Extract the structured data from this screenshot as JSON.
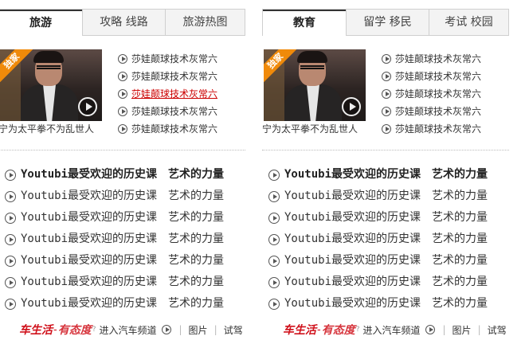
{
  "columns": [
    {
      "tabs": [
        "旅游",
        "攻略 线路",
        "旅游热图"
      ],
      "active_tab": 0,
      "feature": {
        "badge": "独家",
        "caption": "宁为太平拳不为乱世人"
      },
      "small_list": [
        "莎娃颠球技术灰常六",
        "莎娃颠球技术灰常六",
        "莎娃颠球技术灰常六",
        "莎娃颠球技术灰常六",
        "莎娃颠球技术灰常六"
      ],
      "highlight_index": 2,
      "big_list": [
        {
          "t1": "Youtubi最受欢迎的历史课",
          "t2": "艺术的力量",
          "bold": true
        },
        {
          "t1": "Youtubi最受欢迎的历史课",
          "t2": "艺术的力量",
          "bold": false
        },
        {
          "t1": "Youtubi最受欢迎的历史课",
          "t2": "艺术的力量",
          "bold": false
        },
        {
          "t1": "Youtubi最受欢迎的历史课",
          "t2": "艺术的力量",
          "bold": false
        },
        {
          "t1": "Youtubi最受欢迎的历史课",
          "t2": "艺术的力量",
          "bold": false
        },
        {
          "t1": "Youtubi最受欢迎的历史课",
          "t2": "艺术的力量",
          "bold": false
        },
        {
          "t1": "Youtubi最受欢迎的历史课",
          "t2": "艺术的力量",
          "bold": false
        }
      ],
      "footer": {
        "brand_a": "车生活",
        "brand_b": "有态度",
        "brand_q": "?",
        "link": "进入汽车频道",
        "items": [
          "图片",
          "试驾"
        ]
      }
    },
    {
      "tabs": [
        "教育",
        "留学 移民",
        "考试 校园"
      ],
      "active_tab": 0,
      "feature": {
        "badge": "独家",
        "caption": "宁为太平拳不为乱世人"
      },
      "small_list": [
        "莎娃颠球技术灰常六",
        "莎娃颠球技术灰常六",
        "莎娃颠球技术灰常六",
        "莎娃颠球技术灰常六",
        "莎娃颠球技术灰常六"
      ],
      "highlight_index": -1,
      "big_list": [
        {
          "t1": "Youtubi最受欢迎的历史课",
          "t2": "艺术的力量",
          "bold": true
        },
        {
          "t1": "Youtubi最受欢迎的历史课",
          "t2": "艺术的力量",
          "bold": false
        },
        {
          "t1": "Youtubi最受欢迎的历史课",
          "t2": "艺术的力量",
          "bold": false
        },
        {
          "t1": "Youtubi最受欢迎的历史课",
          "t2": "艺术的力量",
          "bold": false
        },
        {
          "t1": "Youtubi最受欢迎的历史课",
          "t2": "艺术的力量",
          "bold": false
        },
        {
          "t1": "Youtubi最受欢迎的历史课",
          "t2": "艺术的力量",
          "bold": false
        },
        {
          "t1": "Youtubi最受欢迎的历史课",
          "t2": "艺术的力量",
          "bold": false
        }
      ],
      "footer": {
        "brand_a": "车生活",
        "brand_b": "有态度",
        "brand_q": "?",
        "link": "进入汽车频道",
        "items": [
          "图片",
          "试驾"
        ]
      }
    }
  ],
  "colors": {
    "highlight": "#cc0000",
    "brand": "#d0111b",
    "badge": "#f08a0a"
  }
}
